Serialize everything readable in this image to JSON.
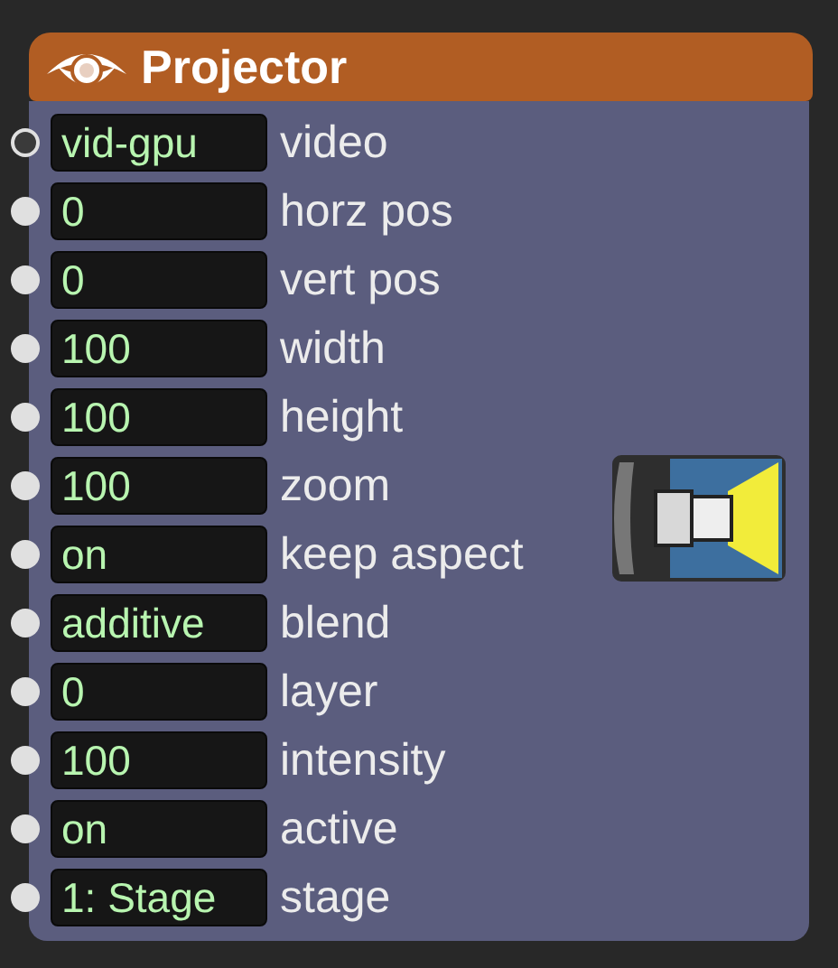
{
  "actor": {
    "title": "Projector"
  },
  "inputs": [
    {
      "kind": "video",
      "value": "vid-gpu",
      "label": "video"
    },
    {
      "kind": "value",
      "value": "0",
      "label": "horz pos"
    },
    {
      "kind": "value",
      "value": "0",
      "label": "vert pos"
    },
    {
      "kind": "value",
      "value": "100",
      "label": "width"
    },
    {
      "kind": "value",
      "value": "100",
      "label": "height"
    },
    {
      "kind": "value",
      "value": "100",
      "label": "zoom"
    },
    {
      "kind": "value",
      "value": "on",
      "label": "keep aspect"
    },
    {
      "kind": "value",
      "value": "additive",
      "label": "blend"
    },
    {
      "kind": "value",
      "value": "0",
      "label": "layer"
    },
    {
      "kind": "value",
      "value": "100",
      "label": "intensity"
    },
    {
      "kind": "value",
      "value": "on",
      "label": "active"
    },
    {
      "kind": "value",
      "value": "1: Stage",
      "label": "stage"
    }
  ]
}
